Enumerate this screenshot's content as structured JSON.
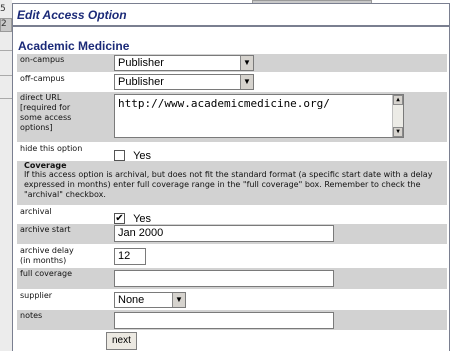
{
  "background": {
    "fragment_left_text": "5",
    "fragment_left_box_text": "2"
  },
  "panel": {
    "title": "Edit Access Option",
    "journal_title": "Academic Medicine"
  },
  "fields": {
    "on_campus": {
      "label": "on-campus",
      "value": "Publisher"
    },
    "off_campus": {
      "label": "off-campus",
      "value": "Publisher"
    },
    "direct_url": {
      "label_line1": "direct URL",
      "label_line2": "[required for",
      "label_line3": "some access",
      "label_line4": "options]",
      "value": "http://www.academicmedicine.org/"
    },
    "hide_option": {
      "label": "hide this option",
      "checkbox_label": "Yes",
      "checked": false
    },
    "coverage": {
      "heading": "Coverage",
      "note": "If this access option is archival, but does not fit the standard format (a specific start date with a delay expressed in months) enter full coverage range in the \"full coverage\" box. Remember to check the \"archival\" checkbox."
    },
    "archival": {
      "label": "archival",
      "checkbox_label": "Yes",
      "checked": true,
      "check_mark": "✔"
    },
    "archive_start": {
      "label": "archive start",
      "value": "Jan 2000"
    },
    "archive_delay": {
      "label_line1": "archive delay",
      "label_line2": "(in months)",
      "value": "12"
    },
    "full_coverage": {
      "label": "full coverage",
      "value": ""
    },
    "supplier": {
      "label": "supplier",
      "value": "None"
    },
    "notes": {
      "label": "notes",
      "value": ""
    }
  },
  "buttons": {
    "next": "next"
  },
  "icons": {
    "select_arrow": "▼",
    "scroll_up": "▲",
    "scroll_down": "▼"
  },
  "colors": {
    "title_blue": "#1b2a78",
    "row_alt": "#d2d2d2",
    "border": "#7a7f90"
  }
}
